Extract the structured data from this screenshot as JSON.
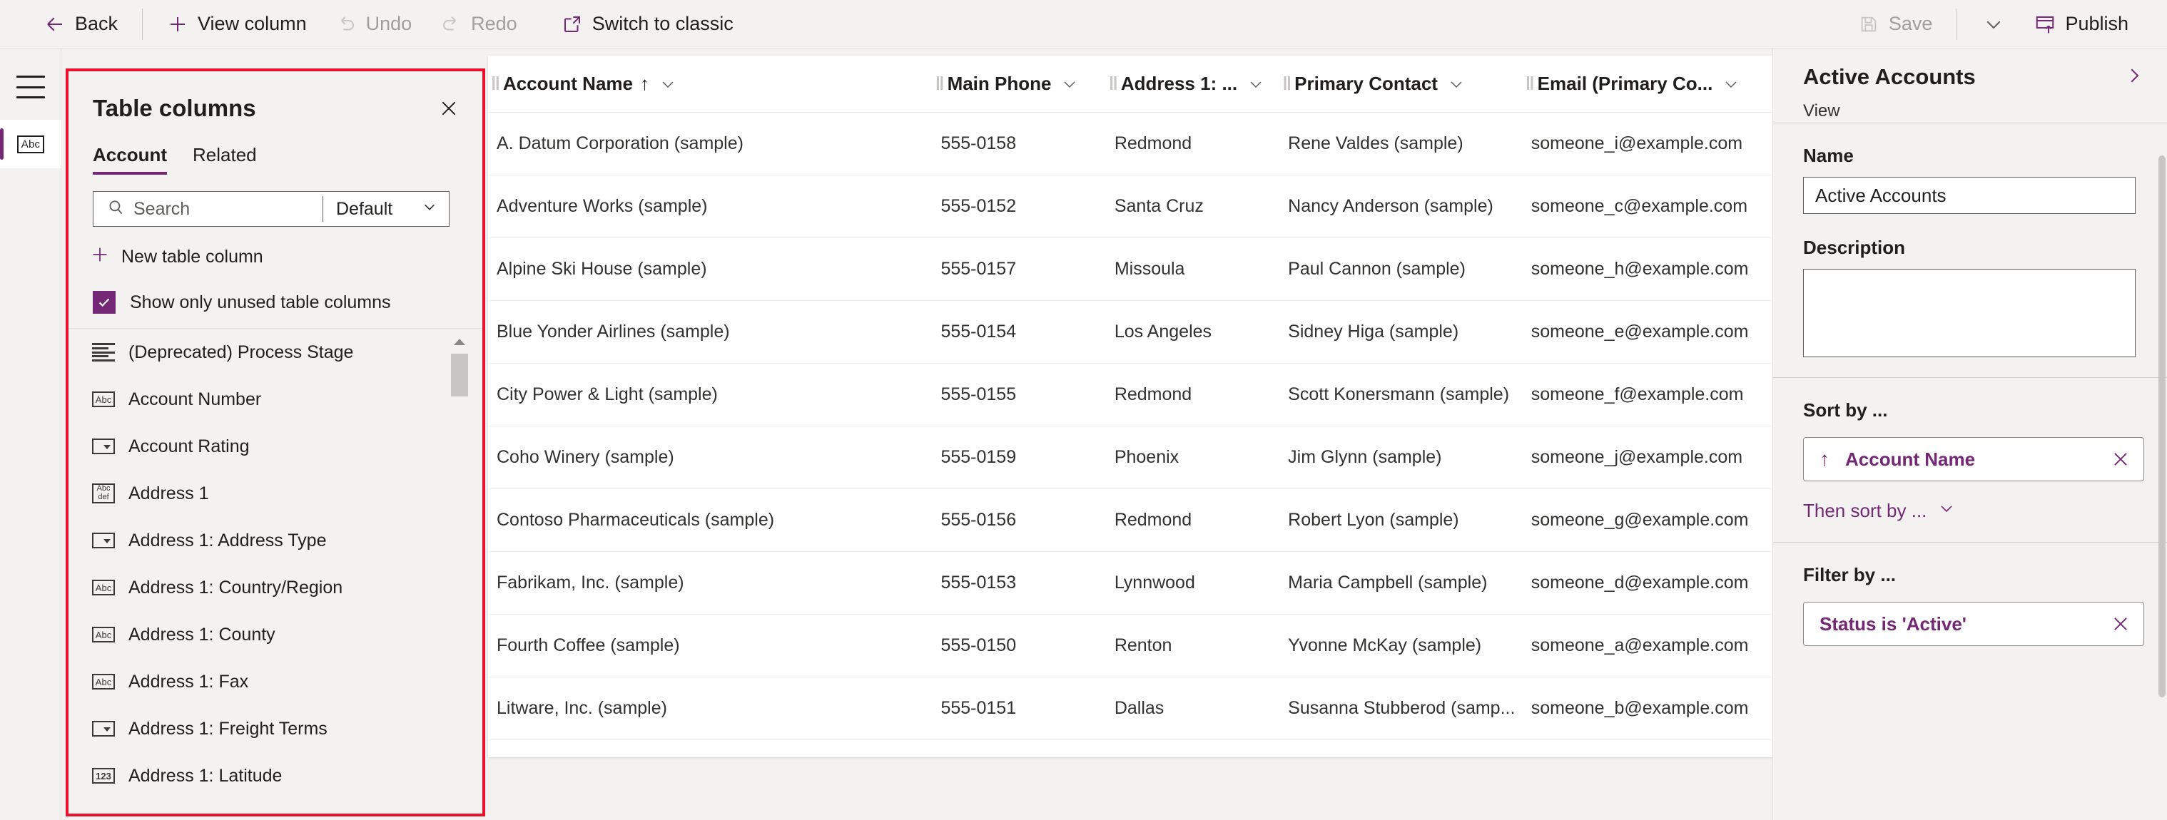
{
  "commandbar": {
    "back_label": "Back",
    "view_column_label": "View column",
    "undo_label": "Undo",
    "redo_label": "Redo",
    "switch_label": "Switch to classic",
    "save_label": "Save",
    "publish_label": "Publish"
  },
  "rail": {
    "menu_name": "hamburger-menu",
    "item_badge": "Abc"
  },
  "table_columns_panel": {
    "title": "Table columns",
    "tabs": [
      {
        "label": "Account",
        "active": true
      },
      {
        "label": "Related",
        "active": false
      }
    ],
    "search_placeholder": "Search",
    "filter_value": "Default",
    "new_column_label": "New table column",
    "checkbox_label": "Show only unused table columns",
    "checkbox_checked": true,
    "columns": [
      {
        "label": "(Deprecated) Process Stage",
        "icon": "multiline-text-icon",
        "glyph": "lines"
      },
      {
        "label": "Account Number",
        "icon": "text-icon",
        "glyph": "abc"
      },
      {
        "label": "Account Rating",
        "icon": "choice-icon",
        "glyph": "opt"
      },
      {
        "label": "Address 1",
        "icon": "multiline-text-icon",
        "glyph": "abcdef"
      },
      {
        "label": "Address 1: Address Type",
        "icon": "choice-icon",
        "glyph": "opt"
      },
      {
        "label": "Address 1: Country/Region",
        "icon": "text-icon",
        "glyph": "abc"
      },
      {
        "label": "Address 1: County",
        "icon": "text-icon",
        "glyph": "abc"
      },
      {
        "label": "Address 1: Fax",
        "icon": "text-icon",
        "glyph": "abc"
      },
      {
        "label": "Address 1: Freight Terms",
        "icon": "choice-icon",
        "glyph": "opt"
      },
      {
        "label": "Address 1: Latitude",
        "icon": "number-icon",
        "glyph": "123"
      }
    ]
  },
  "grid": {
    "headers": [
      {
        "label": "Account Name",
        "sorted": true,
        "sort_glyph": "↑"
      },
      {
        "label": "Main Phone",
        "sorted": false
      },
      {
        "label": "Address 1: ...",
        "sorted": false
      },
      {
        "label": "Primary Contact",
        "sorted": false
      },
      {
        "label": "Email (Primary Co...",
        "sorted": false
      }
    ],
    "rows": [
      {
        "name": "A. Datum Corporation (sample)",
        "phone": "555-0158",
        "city": "Redmond",
        "contact": "Rene Valdes (sample)",
        "email": "someone_i@example.com"
      },
      {
        "name": "Adventure Works (sample)",
        "phone": "555-0152",
        "city": "Santa Cruz",
        "contact": "Nancy Anderson (sample)",
        "email": "someone_c@example.com"
      },
      {
        "name": "Alpine Ski House (sample)",
        "phone": "555-0157",
        "city": "Missoula",
        "contact": "Paul Cannon (sample)",
        "email": "someone_h@example.com"
      },
      {
        "name": "Blue Yonder Airlines (sample)",
        "phone": "555-0154",
        "city": "Los Angeles",
        "contact": "Sidney Higa (sample)",
        "email": "someone_e@example.com"
      },
      {
        "name": "City Power & Light (sample)",
        "phone": "555-0155",
        "city": "Redmond",
        "contact": "Scott Konersmann (sample)",
        "email": "someone_f@example.com"
      },
      {
        "name": "Coho Winery (sample)",
        "phone": "555-0159",
        "city": "Phoenix",
        "contact": "Jim Glynn (sample)",
        "email": "someone_j@example.com"
      },
      {
        "name": "Contoso Pharmaceuticals (sample)",
        "phone": "555-0156",
        "city": "Redmond",
        "contact": "Robert Lyon (sample)",
        "email": "someone_g@example.com"
      },
      {
        "name": "Fabrikam, Inc. (sample)",
        "phone": "555-0153",
        "city": "Lynnwood",
        "contact": "Maria Campbell (sample)",
        "email": "someone_d@example.com"
      },
      {
        "name": "Fourth Coffee (sample)",
        "phone": "555-0150",
        "city": "Renton",
        "contact": "Yvonne McKay (sample)",
        "email": "someone_a@example.com"
      },
      {
        "name": "Litware, Inc. (sample)",
        "phone": "555-0151",
        "city": "Dallas",
        "contact": "Susanna Stubberod (samp...",
        "email": "someone_b@example.com"
      }
    ]
  },
  "properties_panel": {
    "title": "Active Accounts",
    "subtitle": "View",
    "name_label": "Name",
    "name_value": "Active Accounts",
    "description_label": "Description",
    "description_value": "",
    "sort_label": "Sort by ...",
    "sort_chip": "Account Name",
    "sort_direction_glyph": "↑",
    "then_sort_label": "Then sort by ...",
    "filter_label": "Filter by ...",
    "filter_chip": "Status is 'Active'"
  },
  "colors": {
    "accent": "#742774",
    "highlight": "#e8112d",
    "chrome": "#f3f2f1",
    "text": "#201f1e"
  }
}
